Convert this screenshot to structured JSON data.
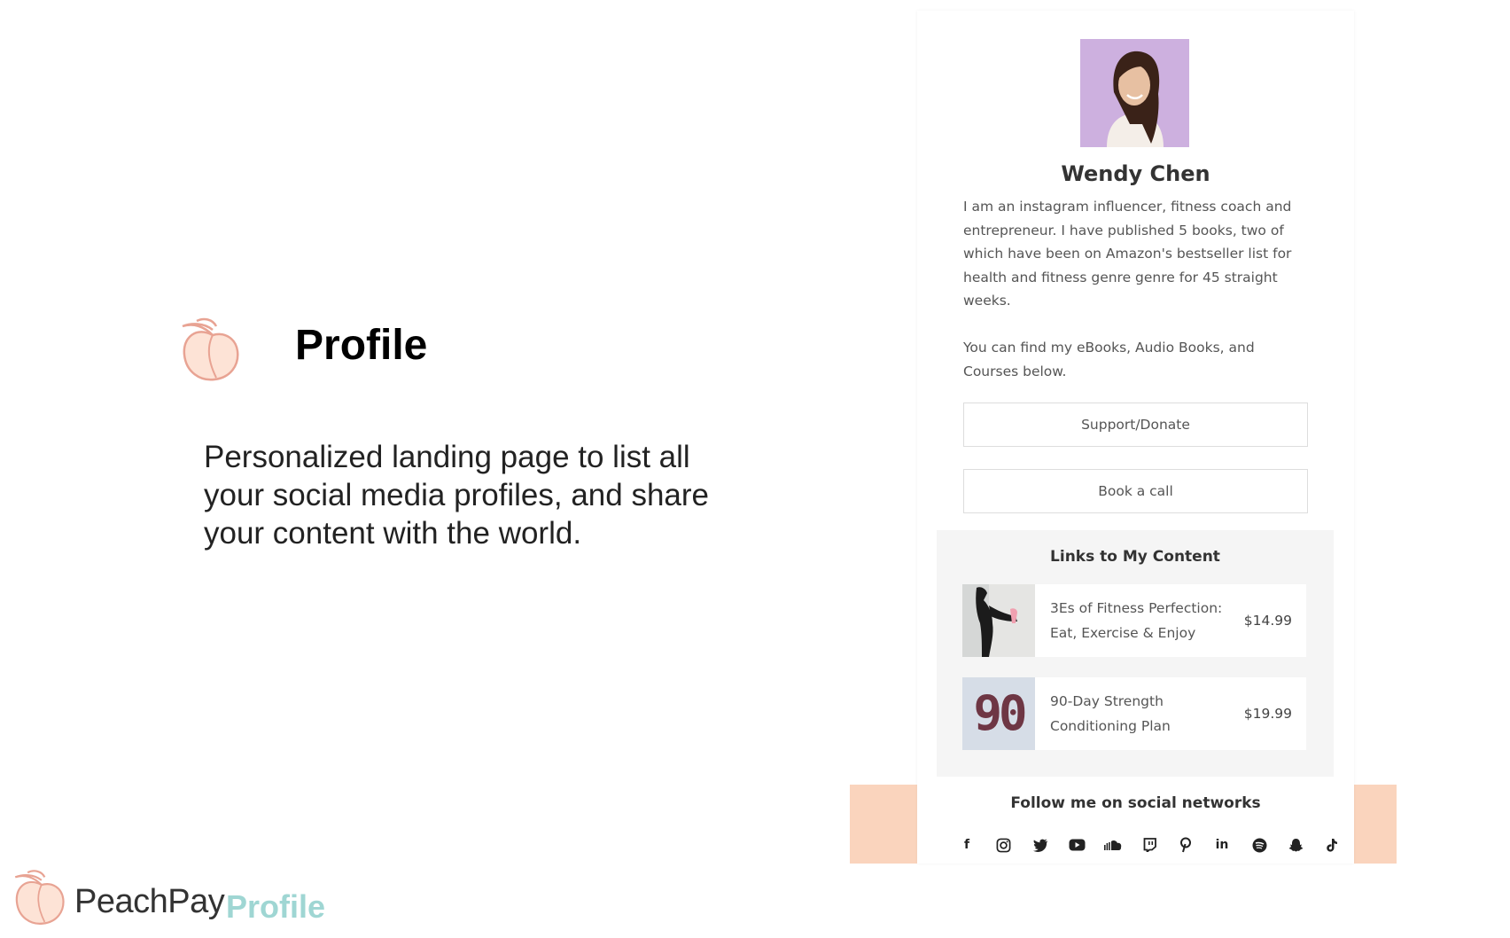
{
  "slide": {
    "title": "Profile",
    "description": "Personalized landing page to list all your social media profiles, and share your content with the world."
  },
  "footer": {
    "brand": "PeachPay",
    "tag": "Profile"
  },
  "profile": {
    "name": "Wendy Chen",
    "bio_paragraph_1": "I am an instagram influencer, fitness coach and entrepreneur. I have published 5 books, two of which have been on Amazon's bestseller list for health and fitness genre genre for 45 straight weeks.",
    "bio_paragraph_2": "You can find my eBooks, Audio Books, and Courses below.",
    "buttons": [
      {
        "label": "Support/Donate"
      },
      {
        "label": "Book a call"
      }
    ],
    "content": {
      "title": "Links to My Content",
      "items": [
        {
          "title": "3Es of Fitness Perfection: Eat, Exercise & Enjoy",
          "price": "$14.99",
          "thumb_icon": "fitness-photo"
        },
        {
          "title": "90-Day Strength Conditioning Plan",
          "price": "$19.99",
          "thumb_icon": "number-90-photo",
          "thumb_text": "90"
        }
      ]
    },
    "social": {
      "title": "Follow me on social networks",
      "icons": [
        {
          "name": "facebook-icon",
          "glyph": "f"
        },
        {
          "name": "instagram-icon",
          "glyph": ""
        },
        {
          "name": "twitter-icon",
          "glyph": ""
        },
        {
          "name": "youtube-icon",
          "glyph": ""
        },
        {
          "name": "soundcloud-icon",
          "glyph": ""
        },
        {
          "name": "twitch-icon",
          "glyph": ""
        },
        {
          "name": "pinterest-icon",
          "glyph": ""
        },
        {
          "name": "linkedin-icon",
          "glyph": "in"
        },
        {
          "name": "spotify-icon",
          "glyph": ""
        },
        {
          "name": "snapchat-icon",
          "glyph": ""
        },
        {
          "name": "tiktok-icon",
          "glyph": ""
        }
      ]
    }
  },
  "colors": {
    "peach": "#fad4bd",
    "brand_teal": "#9fd6d3",
    "panel_gray": "#f5f5f5"
  }
}
